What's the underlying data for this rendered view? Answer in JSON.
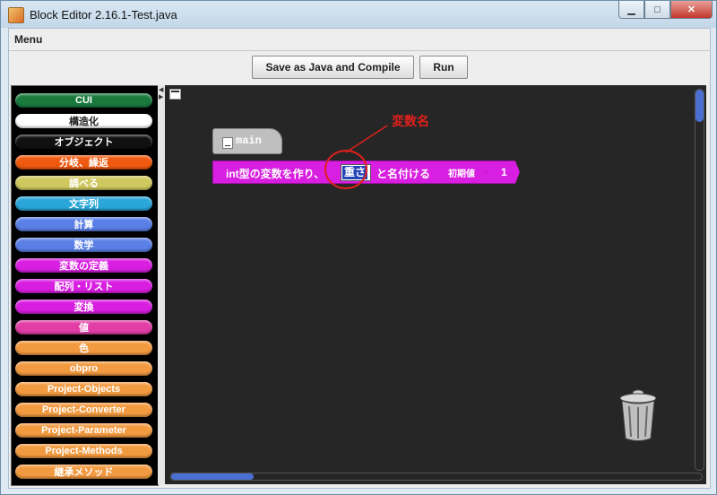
{
  "window": {
    "title": "Block Editor 2.16.1-Test.java",
    "minimize_icon": "minimize-icon",
    "maximize_icon": "maximize-icon",
    "close_icon": "close-icon"
  },
  "menu": {
    "label": "Menu"
  },
  "toolbar": {
    "save_compile_label": "Save as Java and Compile",
    "run_label": "Run"
  },
  "palette": {
    "categories": [
      {
        "label": "CUI",
        "color": "#1a7a3e"
      },
      {
        "label": "構造化",
        "color": "#ffffff"
      },
      {
        "label": "オブジェクト",
        "color": "#111111"
      },
      {
        "label": "分岐、繰返",
        "color": "#f05a10"
      },
      {
        "label": "調べる",
        "color": "#cfc85e"
      },
      {
        "label": "文字列",
        "color": "#2aa7d8"
      },
      {
        "label": "計算",
        "color": "#5a7fe6"
      },
      {
        "label": "数学",
        "color": "#5a7fe6"
      },
      {
        "label": "変数の定義",
        "color": "#d81ee0"
      },
      {
        "label": "配列・リスト",
        "color": "#d81ee0"
      },
      {
        "label": "変換",
        "color": "#d81ee0"
      },
      {
        "label": "値",
        "color": "#e23ea6"
      },
      {
        "label": "色",
        "color": "#f29a40"
      },
      {
        "label": "obpro",
        "color": "#f29a40"
      },
      {
        "label": "Project-Objects",
        "color": "#f29a40"
      },
      {
        "label": "Project-Converter",
        "color": "#f29a40"
      },
      {
        "label": "Project-Parameter",
        "color": "#f29a40"
      },
      {
        "label": "Project-Methods",
        "color": "#f29a40"
      },
      {
        "label": "継承メソッド",
        "color": "#f29a40"
      }
    ]
  },
  "workspace": {
    "main_block": {
      "label": "main",
      "color": "#bfbfbf"
    },
    "variable_block": {
      "prefix": "int型の変数を作り、",
      "name_value": "重さ",
      "suffix": "と名付ける",
      "init_label": "初期値",
      "init_value": "1",
      "color": "#d81ee0"
    },
    "annotation": {
      "text": "変数名",
      "color": "#e0201c"
    }
  }
}
